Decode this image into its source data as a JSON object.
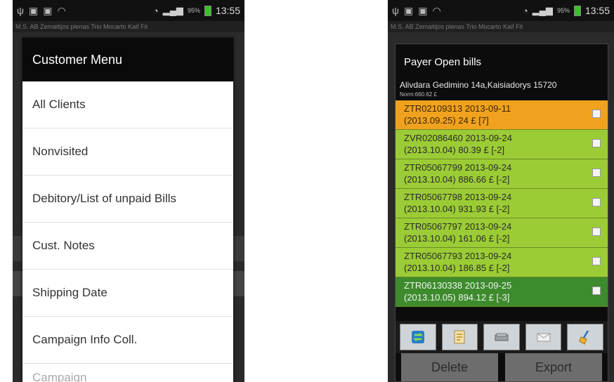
{
  "left_screen": {
    "status": {
      "clock": "13:55",
      "battery": "95%"
    },
    "appbar_text": "M.S. AB Zemaitijos pienas Trio Mocarto Kaif Fit",
    "dialog": {
      "title": "Customer Menu",
      "items": [
        "All Clients",
        "Nonvisited",
        "Debitory/List of unpaid Bills",
        "Cust. Notes",
        "Shipping Date",
        "Campaign Info Coll.",
        "Campaign"
      ]
    }
  },
  "right_screen": {
    "status": {
      "clock": "13:55",
      "battery": "95%"
    },
    "appbar_text": "M.S. AB Zemaitijos pienas Trio Mocarto Kaif Fit",
    "dialog": {
      "title": "Payer Open bills",
      "address": "Alivdara Gedimino 14a,Kaisiadorys 15720",
      "norm": "Norm:660.62 £",
      "bills": [
        {
          "line1": "ZTR02109313 2013-09-11",
          "line2": "(2013.09.25) 24 £ [7]",
          "status": "orange"
        },
        {
          "line1": "ZVR02086460 2013-09-24",
          "line2": "(2013.10.04) 80.39 £ [-2]",
          "status": "green"
        },
        {
          "line1": "ZTR05067799 2013-09-24",
          "line2": "(2013.10.04) 886.66 £ [-2]",
          "status": "green"
        },
        {
          "line1": "ZTR05067798 2013-09-24",
          "line2": "(2013.10.04) 931.93 £ [-2]",
          "status": "green"
        },
        {
          "line1": "ZTR05067797 2013-09-24",
          "line2": "(2013.10.04) 161.06 £ [-2]",
          "status": "green"
        },
        {
          "line1": "ZTR05067793 2013-09-24",
          "line2": "(2013.10.04) 186.85 £ [-2]",
          "status": "green"
        },
        {
          "line1": "ZTR06130338 2013-09-25",
          "line2": "(2013.10.05) 894.12 £ [-3]",
          "status": "dark"
        }
      ],
      "toolbar_icons": [
        "sync-arrows-icon",
        "document-edit-icon",
        "money-stack-icon",
        "envelope-icon",
        "broom-clear-icon"
      ],
      "actions": {
        "delete": "Delete",
        "export": "Export"
      }
    },
    "colors": {
      "orange": "#f0a21e",
      "green": "#9ccc35",
      "dark_green": "#3d8b2d"
    }
  }
}
